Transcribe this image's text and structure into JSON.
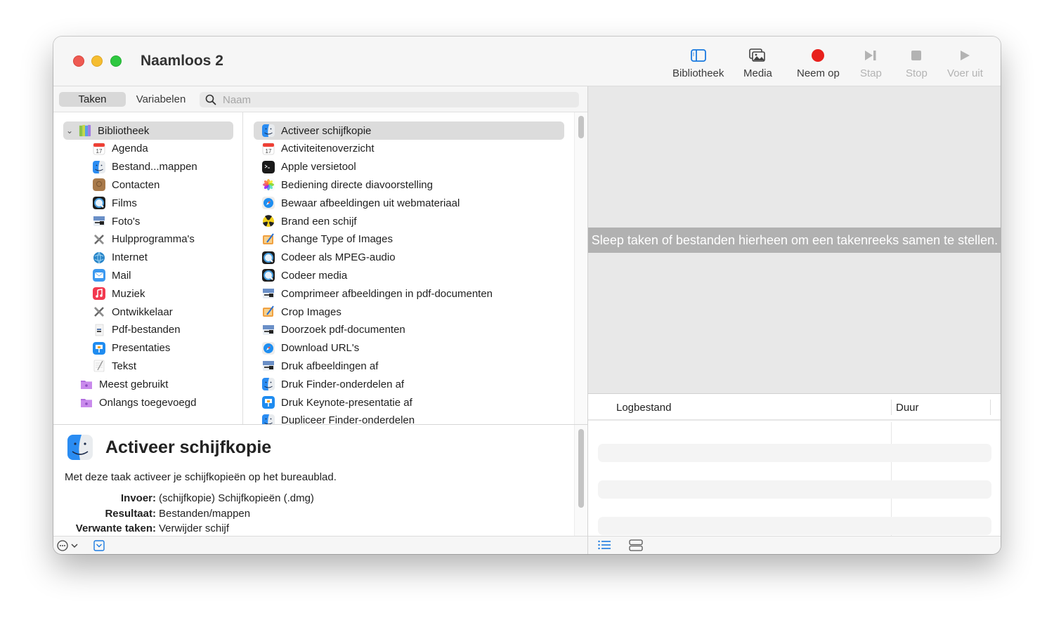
{
  "window": {
    "title": "Naamloos 2"
  },
  "toolbar": {
    "items": [
      {
        "label": "Bibliotheek",
        "icon": "sidebar-icon",
        "enabled": true
      },
      {
        "label": "Media",
        "icon": "photos-icon",
        "enabled": true
      },
      {
        "label": "Neem op",
        "icon": "record-icon",
        "enabled": true
      },
      {
        "label": "Stap",
        "icon": "step-icon",
        "enabled": false
      },
      {
        "label": "Stop",
        "icon": "stop-icon",
        "enabled": false
      },
      {
        "label": "Voer uit",
        "icon": "play-icon",
        "enabled": false
      }
    ],
    "accent": "#1a7ae0",
    "record_color": "#e8211d"
  },
  "tabs": {
    "taken": "Taken",
    "variabelen": "Variabelen",
    "active": "Taken"
  },
  "search": {
    "placeholder": "Naam",
    "value": ""
  },
  "library": {
    "root": {
      "label": "Bibliotheek",
      "expanded": true,
      "selected": true
    },
    "items": [
      {
        "label": "Agenda",
        "icon": "calendar-icon"
      },
      {
        "label": "Bestand...mappen",
        "icon": "finder-icon"
      },
      {
        "label": "Contacten",
        "icon": "contacts-icon"
      },
      {
        "label": "Films",
        "icon": "quicktime-icon"
      },
      {
        "label": "Foto's",
        "icon": "preview-icon"
      },
      {
        "label": "Hulpprogramma's",
        "icon": "utilities-icon"
      },
      {
        "label": "Internet",
        "icon": "globe-icon"
      },
      {
        "label": "Mail",
        "icon": "mail-icon"
      },
      {
        "label": "Muziek",
        "icon": "music-icon"
      },
      {
        "label": "Ontwikkelaar",
        "icon": "developer-icon"
      },
      {
        "label": "Pdf-bestanden",
        "icon": "pdf-icon"
      },
      {
        "label": "Presentaties",
        "icon": "keynote-icon"
      },
      {
        "label": "Tekst",
        "icon": "textedit-icon"
      }
    ],
    "smart_folders": [
      {
        "label": "Meest gebruikt",
        "icon": "smart-folder-icon"
      },
      {
        "label": "Onlangs toegevoegd",
        "icon": "smart-folder-icon"
      }
    ]
  },
  "actions": {
    "selected": "Activeer schijfkopie",
    "items": [
      {
        "label": "Activeer schijfkopie",
        "icon": "finder-icon"
      },
      {
        "label": "Activiteitenoverzicht",
        "icon": "calendar-icon"
      },
      {
        "label": "Apple versietool",
        "icon": "terminal-icon"
      },
      {
        "label": "Bediening directe diavoorstelling",
        "icon": "photos-app-icon"
      },
      {
        "label": "Bewaar afbeeldingen uit webmateriaal",
        "icon": "safari-icon"
      },
      {
        "label": "Brand een schijf",
        "icon": "burn-icon"
      },
      {
        "label": "Change Type of Images",
        "icon": "image-edit-icon"
      },
      {
        "label": "Codeer als MPEG-audio",
        "icon": "quicktime-icon"
      },
      {
        "label": "Codeer media",
        "icon": "quicktime-icon"
      },
      {
        "label": "Comprimeer afbeeldingen in pdf-documenten",
        "icon": "preview-icon"
      },
      {
        "label": "Crop Images",
        "icon": "image-edit-icon"
      },
      {
        "label": "Doorzoek pdf-documenten",
        "icon": "preview-icon"
      },
      {
        "label": "Download URL's",
        "icon": "safari-icon"
      },
      {
        "label": "Druk afbeeldingen af",
        "icon": "preview-icon"
      },
      {
        "label": "Druk Finder-onderdelen af",
        "icon": "finder-icon"
      },
      {
        "label": "Druk Keynote-presentatie af",
        "icon": "keynote-icon"
      },
      {
        "label": "Dupliceer Finder-onderdelen",
        "icon": "finder-icon"
      }
    ]
  },
  "description": {
    "title": "Activeer schijfkopie",
    "text": "Met deze taak activeer je schijfkopieën op het bureaublad.",
    "fields": [
      {
        "key": "Invoer:",
        "value": "(schijfkopie) Schijfkopieën (.dmg)"
      },
      {
        "key": "Resultaat:",
        "value": "Bestanden/mappen"
      },
      {
        "key": "Verwante taken:",
        "value": "Verwijder schijf"
      }
    ]
  },
  "workflow": {
    "hint": "Sleep taken of bestanden hierheen om een takenreeks samen te stellen."
  },
  "log": {
    "columns": [
      "Logbestand",
      "Duur"
    ],
    "rows": []
  }
}
